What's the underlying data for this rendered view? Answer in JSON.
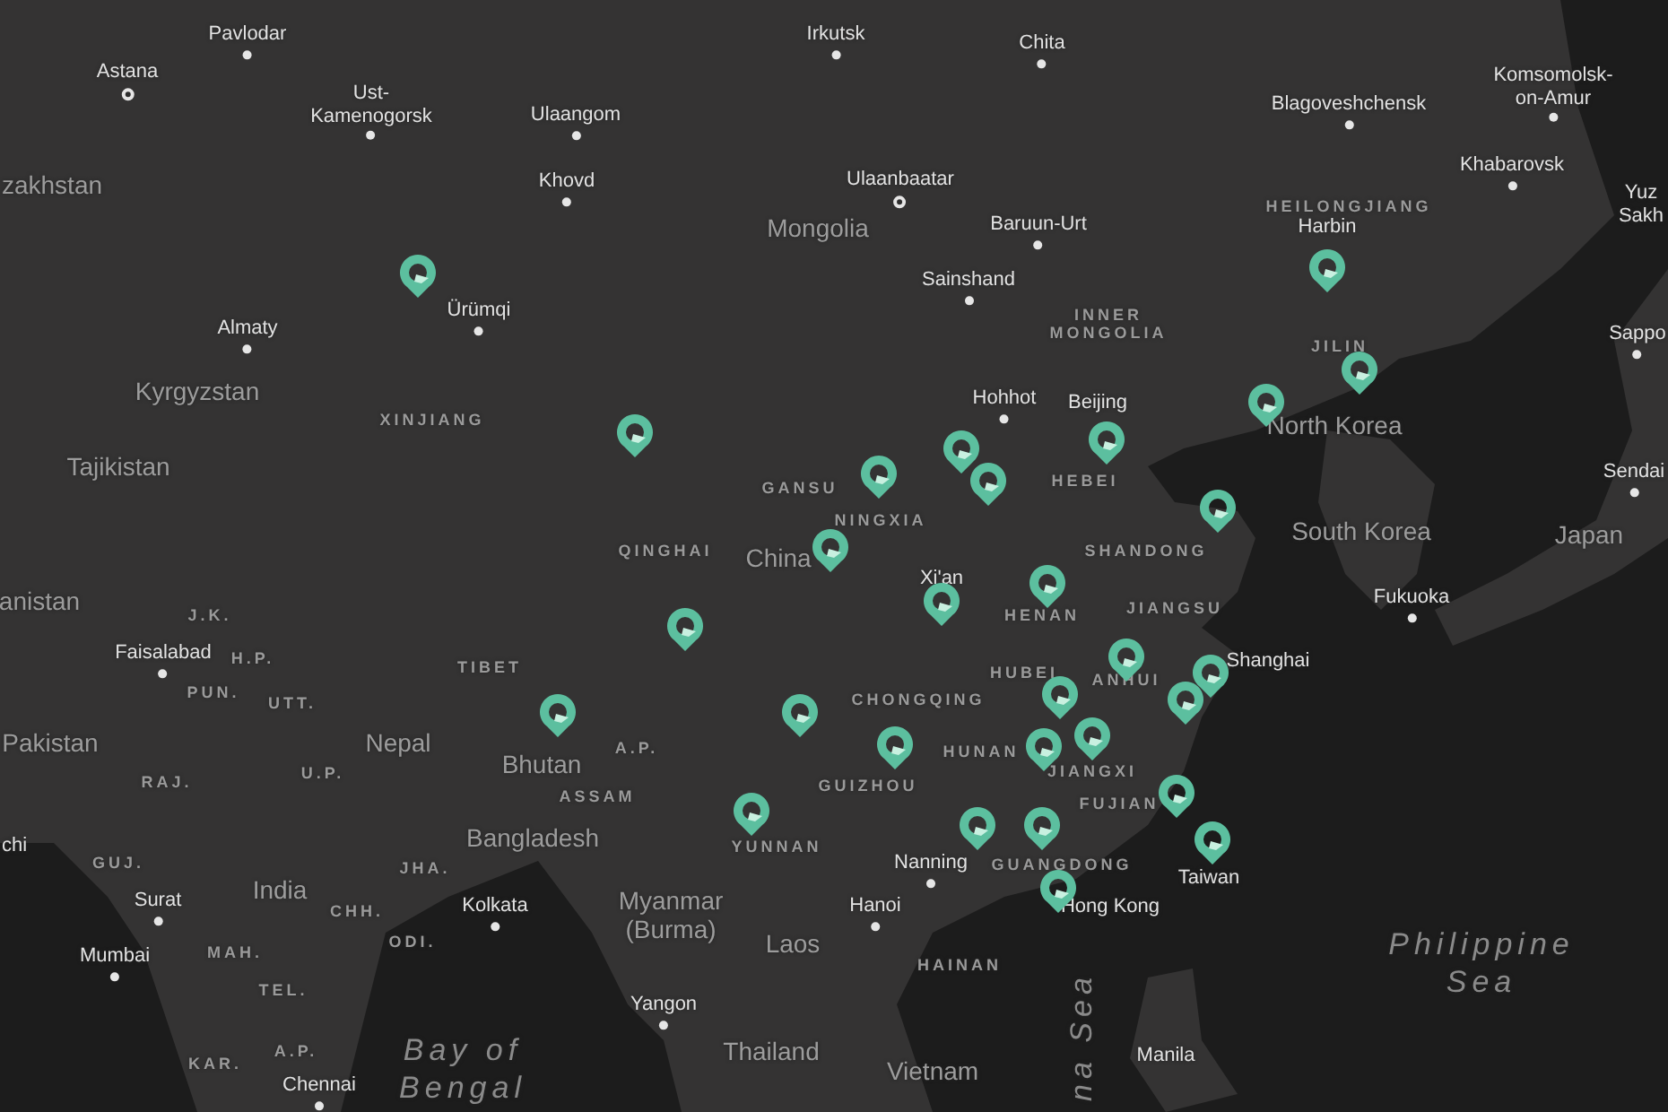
{
  "map_labels": [
    {
      "text": "Pavlodar",
      "kind": "city"
    },
    {
      "text": "Astana",
      "kind": "capital"
    },
    {
      "text": "Ust-\nKamenogorsk",
      "kind": "city"
    },
    {
      "text": "Ulaangom",
      "kind": "city"
    },
    {
      "text": "Khovd",
      "kind": "city"
    },
    {
      "text": "Ürümqi",
      "kind": "city"
    },
    {
      "text": "Almaty",
      "kind": "city"
    },
    {
      "text": "Irkutsk",
      "kind": "city"
    },
    {
      "text": "Chita",
      "kind": "city"
    },
    {
      "text": "Blagoveshchensk",
      "kind": "city"
    },
    {
      "text": "Komsomolsk-\non-Amur",
      "kind": "city"
    },
    {
      "text": "Khabarovsk",
      "kind": "city"
    },
    {
      "text": "Ulaanbaatar",
      "kind": "capital"
    },
    {
      "text": "Baruun-Urt",
      "kind": "city"
    },
    {
      "text": "Sainshand",
      "kind": "city"
    },
    {
      "text": "Harbin",
      "kind": "place"
    },
    {
      "text": "Yuz\nSakh",
      "kind": "place"
    },
    {
      "text": "Sappo",
      "kind": "city"
    },
    {
      "text": "Hohhot",
      "kind": "city"
    },
    {
      "text": "Beijing",
      "kind": "place"
    },
    {
      "text": "Sendai",
      "kind": "city"
    },
    {
      "text": "Fukuoka",
      "kind": "city"
    },
    {
      "text": "Xi'an",
      "kind": "place"
    },
    {
      "text": "Shanghai",
      "kind": "place"
    },
    {
      "text": "Faisalabad",
      "kind": "city"
    },
    {
      "text": "Surat",
      "kind": "city"
    },
    {
      "text": "Mumbai",
      "kind": "city"
    },
    {
      "text": "Kolkata",
      "kind": "city"
    },
    {
      "text": "chi",
      "kind": "place"
    },
    {
      "text": "Yangon",
      "kind": "city"
    },
    {
      "text": "Chennai",
      "kind": "city"
    },
    {
      "text": "Nanning",
      "kind": "city"
    },
    {
      "text": "Hanoi",
      "kind": "city"
    },
    {
      "text": "Hong Kong",
      "kind": "place"
    },
    {
      "text": "Taiwan",
      "kind": "place"
    },
    {
      "text": "Manila",
      "kind": "place"
    },
    {
      "text": "zakhstan",
      "kind": "country"
    },
    {
      "text": "Mongolia",
      "kind": "country"
    },
    {
      "text": "Kyrgyzstan",
      "kind": "country"
    },
    {
      "text": "Tajikistan",
      "kind": "country"
    },
    {
      "text": "China",
      "kind": "country"
    },
    {
      "text": "North Korea",
      "kind": "country"
    },
    {
      "text": "South Korea",
      "kind": "country"
    },
    {
      "text": "Japan",
      "kind": "country"
    },
    {
      "text": "anistan",
      "kind": "country"
    },
    {
      "text": "Pakistan",
      "kind": "country"
    },
    {
      "text": "Nepal",
      "kind": "country"
    },
    {
      "text": "Bhutan",
      "kind": "country"
    },
    {
      "text": "Bangladesh",
      "kind": "country"
    },
    {
      "text": "India",
      "kind": "country"
    },
    {
      "text": "Myanmar\n(Burma)",
      "kind": "country"
    },
    {
      "text": "Laos",
      "kind": "country"
    },
    {
      "text": "Thailand",
      "kind": "country"
    },
    {
      "text": "Vietnam",
      "kind": "country"
    },
    {
      "text": "XINJIANG",
      "kind": "region"
    },
    {
      "text": "GANSU",
      "kind": "region"
    },
    {
      "text": "NINGXIA",
      "kind": "region"
    },
    {
      "text": "QINGHAI",
      "kind": "region"
    },
    {
      "text": "HEBEI",
      "kind": "region"
    },
    {
      "text": "SHANDONG",
      "kind": "region"
    },
    {
      "text": "HENAN",
      "kind": "region"
    },
    {
      "text": "JIANGSU",
      "kind": "region"
    },
    {
      "text": "HUBEI",
      "kind": "region"
    },
    {
      "text": "ANHUI",
      "kind": "region"
    },
    {
      "text": "CHONGQING",
      "kind": "region"
    },
    {
      "text": "TIBET",
      "kind": "region"
    },
    {
      "text": "HUNAN",
      "kind": "region"
    },
    {
      "text": "JIANGXI",
      "kind": "region"
    },
    {
      "text": "GUIZHOU",
      "kind": "region"
    },
    {
      "text": "FUJIAN",
      "kind": "region"
    },
    {
      "text": "GUANGDONG",
      "kind": "region"
    },
    {
      "text": "YUNNAN",
      "kind": "region"
    },
    {
      "text": "HAINAN",
      "kind": "region"
    },
    {
      "text": "HEILONGJIANG",
      "kind": "region"
    },
    {
      "text": "INNER\nMONGOLIA",
      "kind": "region"
    },
    {
      "text": "JILIN",
      "kind": "region"
    },
    {
      "text": "ASSAM",
      "kind": "region"
    },
    {
      "text": "A.P.",
      "kind": "region"
    },
    {
      "text": "J.K.",
      "kind": "region"
    },
    {
      "text": "H.P.",
      "kind": "region"
    },
    {
      "text": "PUN.",
      "kind": "region"
    },
    {
      "text": "UTT.",
      "kind": "region"
    },
    {
      "text": "U.P.",
      "kind": "region"
    },
    {
      "text": "RAJ.",
      "kind": "region"
    },
    {
      "text": "GUJ.",
      "kind": "region"
    },
    {
      "text": "JHA.",
      "kind": "region"
    },
    {
      "text": "CHH.",
      "kind": "region"
    },
    {
      "text": "ODI.",
      "kind": "region"
    },
    {
      "text": "MAH.",
      "kind": "region"
    },
    {
      "text": "TEL.",
      "kind": "region"
    },
    {
      "text": "KAR.",
      "kind": "region"
    },
    {
      "text": "A.P.",
      "kind": "region"
    },
    {
      "text": "Bay of\nBengal",
      "kind": "sea"
    },
    {
      "text": "Philippine\nSea",
      "kind": "sea"
    },
    {
      "text": "na Sea",
      "kind": "sea_vertical"
    }
  ]
}
